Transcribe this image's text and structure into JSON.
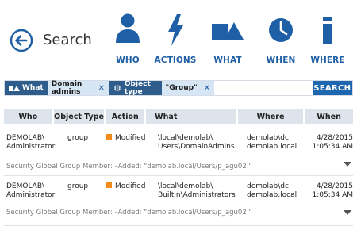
{
  "header": {
    "title": "Search"
  },
  "nav": {
    "who": "WHO",
    "actions": "ACTIONS",
    "what": "WHAT",
    "when": "WHEN",
    "where": "WHERE"
  },
  "filters": [
    {
      "label": "What",
      "value": "Domain admins"
    },
    {
      "label": "Object type",
      "value": "\"Group\""
    }
  ],
  "search": {
    "button_label": "SEARCH",
    "value": ""
  },
  "table": {
    "columns": [
      "Who",
      "Object Type",
      "Action",
      "What",
      "Where",
      "When"
    ],
    "rows": [
      {
        "who": [
          "DEMOLAB\\",
          "Administrator"
        ],
        "object_type": "group",
        "action": "Modified",
        "what": [
          "\\local\\demolab\\",
          "Users\\DomainAdmins"
        ],
        "where": [
          "demolab\\dc.",
          "demolab.local"
        ],
        "when": [
          "4/28/2015",
          "1:05:34 AM"
        ],
        "detail": "Security Global Group Member: –Added: \"demolab.local/Users/p_agu02 \""
      },
      {
        "who": [
          "DEMOLAB\\",
          "Administrator"
        ],
        "object_type": "group",
        "action": "Modified",
        "what": [
          "\\local\\demolab\\",
          "Builtin\\Administrators"
        ],
        "where": [
          "demolab\\dc.",
          "demolab.local"
        ],
        "when": [
          "4/28/2015",
          "1:05:34 AM"
        ],
        "detail": "Security Global Group Member: –Added: \"demolab.local/Users/p_agu02 \""
      }
    ]
  },
  "colors": {
    "accent": "#1f5fa5",
    "chip_dark": "#2e5d8c",
    "chip_light": "#d7e6f4",
    "status": "#f28c1a"
  }
}
